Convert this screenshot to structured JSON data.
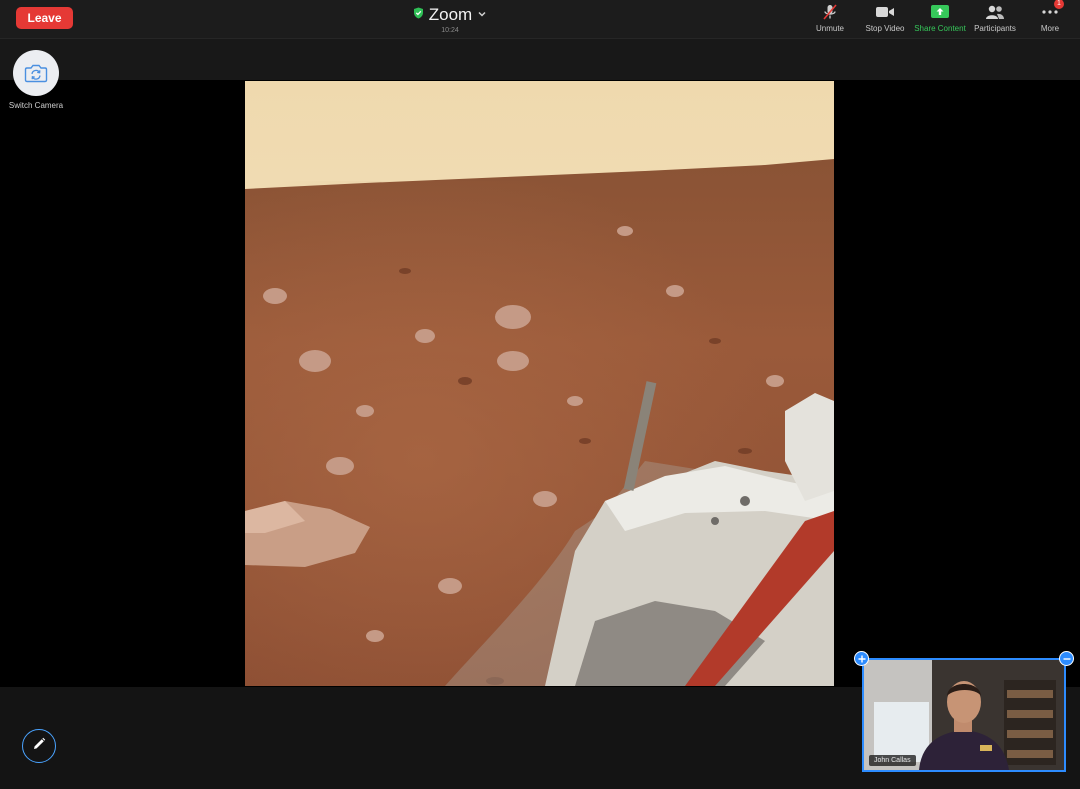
{
  "meeting": {
    "leave_label": "Leave",
    "title": "Zoom",
    "timer": "10:24"
  },
  "toolbar": {
    "items": [
      {
        "label": "Unmute",
        "icon": "mic-muted-icon"
      },
      {
        "label": "Stop Video",
        "icon": "video-camera-icon"
      },
      {
        "label": "Share Content",
        "icon": "share-screen-icon"
      },
      {
        "label": "Participants",
        "icon": "participants-icon"
      },
      {
        "label": "More",
        "icon": "more-icon",
        "badge": "1"
      }
    ]
  },
  "switch_camera": {
    "label": "Switch Camera",
    "icon": "camera-switch-icon"
  },
  "self_view": {
    "name": "John Callas"
  },
  "colors": {
    "leave": "#e53935",
    "accent": "#2d8cff",
    "share_active": "#36c75a",
    "topbar": "#1c1c1c"
  }
}
